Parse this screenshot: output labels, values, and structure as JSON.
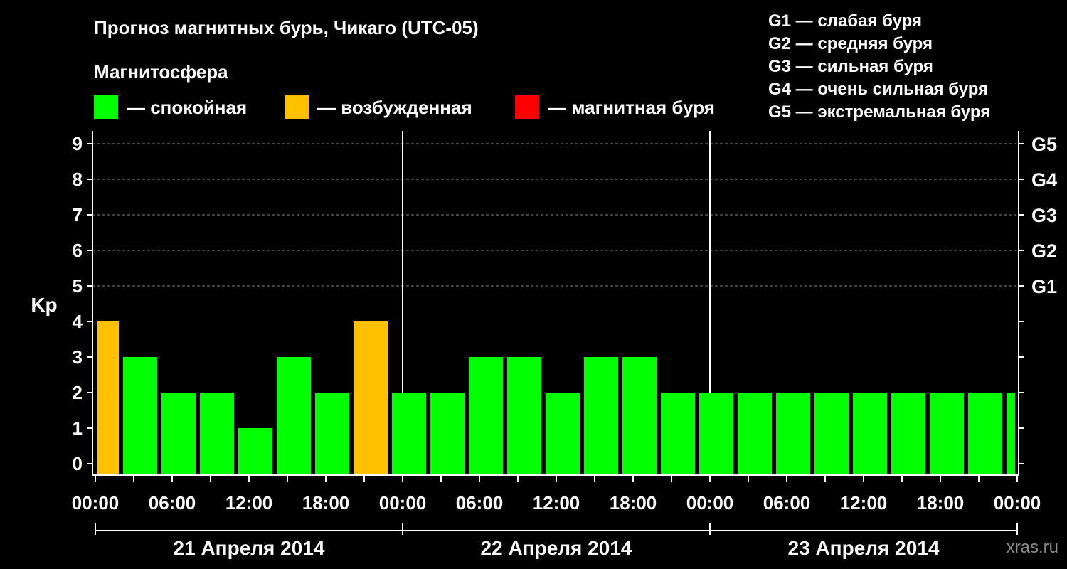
{
  "title": "Прогноз магнитных бурь, Чикаго (UTC-05)",
  "legend": {
    "title": "Магнитосфера",
    "items": [
      {
        "label": "— спокойная",
        "color": "#00ff00"
      },
      {
        "label": "— возбужденная",
        "color": "#ffc000"
      },
      {
        "label": "— магнитная буря",
        "color": "#ff0000"
      }
    ]
  },
  "storm_scale": [
    "G1 — слабая буря",
    "G2 — средняя буря",
    "G3 — сильная буря",
    "G4 — очень сильная буря",
    "G5 — экстремальная буря"
  ],
  "watermark": "xras.ru",
  "chart_data": {
    "type": "bar",
    "title": "Прогноз магнитных бурь, Чикаго (UTC-05)",
    "ylabel": "Kp",
    "ylim": [
      0,
      9
    ],
    "y_ticks": [
      "0",
      "1",
      "2",
      "3",
      "4",
      "5",
      "6",
      "7",
      "8",
      "9"
    ],
    "right_axis_labels": [
      {
        "kp": 5,
        "label": "G1"
      },
      {
        "kp": 6,
        "label": "G2"
      },
      {
        "kp": 7,
        "label": "G3"
      },
      {
        "kp": 8,
        "label": "G4"
      },
      {
        "kp": 9,
        "label": "G5"
      }
    ],
    "x_tick_labels": [
      "00:00",
      "06:00",
      "12:00",
      "18:00",
      "00:00",
      "06:00",
      "12:00",
      "18:00",
      "00:00",
      "06:00",
      "12:00",
      "18:00",
      "00:00"
    ],
    "dates": [
      "21 Апреля 2014",
      "22 Апреля 2014",
      "23 Апреля 2014"
    ],
    "bars": [
      {
        "start_hour": 0,
        "end_hour": 2,
        "kp": 4,
        "level": "возбужденная"
      },
      {
        "start_hour": 2,
        "end_hour": 5,
        "kp": 3,
        "level": "спокойная"
      },
      {
        "start_hour": 5,
        "end_hour": 8,
        "kp": 2,
        "level": "спокойная"
      },
      {
        "start_hour": 8,
        "end_hour": 11,
        "kp": 2,
        "level": "спокойная"
      },
      {
        "start_hour": 11,
        "end_hour": 14,
        "kp": 1,
        "level": "спокойная"
      },
      {
        "start_hour": 14,
        "end_hour": 17,
        "kp": 3,
        "level": "спокойная"
      },
      {
        "start_hour": 17,
        "end_hour": 20,
        "kp": 2,
        "level": "спокойная"
      },
      {
        "start_hour": 20,
        "end_hour": 23,
        "kp": 4,
        "level": "возбужденная"
      },
      {
        "start_hour": 23,
        "end_hour": 26,
        "kp": 2,
        "level": "спокойная"
      },
      {
        "start_hour": 26,
        "end_hour": 29,
        "kp": 2,
        "level": "спокойная"
      },
      {
        "start_hour": 29,
        "end_hour": 32,
        "kp": 3,
        "level": "спокойная"
      },
      {
        "start_hour": 32,
        "end_hour": 35,
        "kp": 3,
        "level": "спокойная"
      },
      {
        "start_hour": 35,
        "end_hour": 38,
        "kp": 2,
        "level": "спокойная"
      },
      {
        "start_hour": 38,
        "end_hour": 41,
        "kp": 3,
        "level": "спокойная"
      },
      {
        "start_hour": 41,
        "end_hour": 44,
        "kp": 3,
        "level": "спокойная"
      },
      {
        "start_hour": 44,
        "end_hour": 47,
        "kp": 2,
        "level": "спокойная"
      },
      {
        "start_hour": 47,
        "end_hour": 50,
        "kp": 2,
        "level": "спокойная"
      },
      {
        "start_hour": 50,
        "end_hour": 53,
        "kp": 2,
        "level": "спокойная"
      },
      {
        "start_hour": 53,
        "end_hour": 56,
        "kp": 2,
        "level": "спокойная"
      },
      {
        "start_hour": 56,
        "end_hour": 59,
        "kp": 2,
        "level": "спокойная"
      },
      {
        "start_hour": 59,
        "end_hour": 62,
        "kp": 2,
        "level": "спокойная"
      },
      {
        "start_hour": 62,
        "end_hour": 65,
        "kp": 2,
        "level": "спокойная"
      },
      {
        "start_hour": 65,
        "end_hour": 68,
        "kp": 2,
        "level": "спокойная"
      },
      {
        "start_hour": 68,
        "end_hour": 71,
        "kp": 2,
        "level": "спокойная"
      },
      {
        "start_hour": 71,
        "end_hour": 72,
        "kp": 2,
        "level": "спокойная"
      }
    ],
    "grid": "dashed horizontal at Kp 5–9, vertical day separators"
  }
}
